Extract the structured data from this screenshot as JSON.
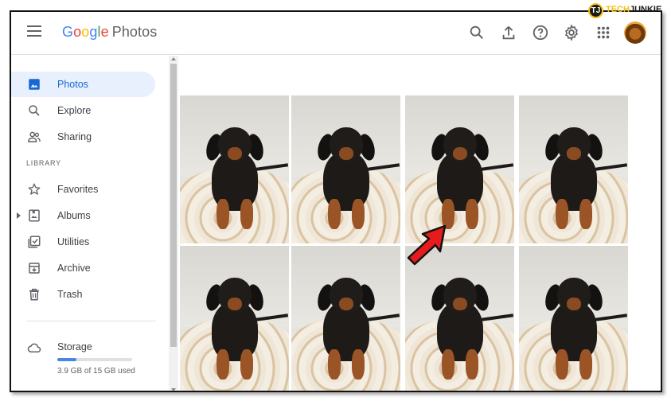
{
  "header": {
    "logo": {
      "g1": "G",
      "g2": "o",
      "g3": "o",
      "g4": "g",
      "g5": "l",
      "g6": "e",
      "product": "Photos"
    },
    "actions": [
      "search-icon",
      "upload-icon",
      "help-icon",
      "settings-icon",
      "apps-icon",
      "account-avatar"
    ]
  },
  "sidebar": {
    "items": [
      {
        "label": "Photos",
        "icon": "photo-icon",
        "active": true
      },
      {
        "label": "Explore",
        "icon": "search-icon"
      },
      {
        "label": "Sharing",
        "icon": "people-icon"
      }
    ],
    "library_heading": "LIBRARY",
    "library_items": [
      {
        "label": "Favorites",
        "icon": "star-icon"
      },
      {
        "label": "Albums",
        "icon": "album-icon"
      },
      {
        "label": "Utilities",
        "icon": "checkbox-icon"
      },
      {
        "label": "Archive",
        "icon": "archive-icon"
      },
      {
        "label": "Trash",
        "icon": "trash-icon"
      }
    ],
    "storage": {
      "label": "Storage",
      "detail": "3.9 GB of 15 GB used",
      "fraction_used": 0.26,
      "icon": "cloud-icon"
    }
  },
  "grid": {
    "photos": [
      "dog-photo",
      "dog-photo",
      "dog-photo",
      "dog-photo",
      "dog-photo",
      "dog-photo",
      "dog-photo",
      "dog-photo"
    ],
    "annotation": "red-arrow-icon"
  },
  "watermark": {
    "badge": "TJ",
    "part1": "TECH",
    "part2": "JUNKIE"
  },
  "colors": {
    "accent": "#1967d2",
    "active_bg": "#e8f0fe",
    "arrow": "#e61b1b"
  }
}
